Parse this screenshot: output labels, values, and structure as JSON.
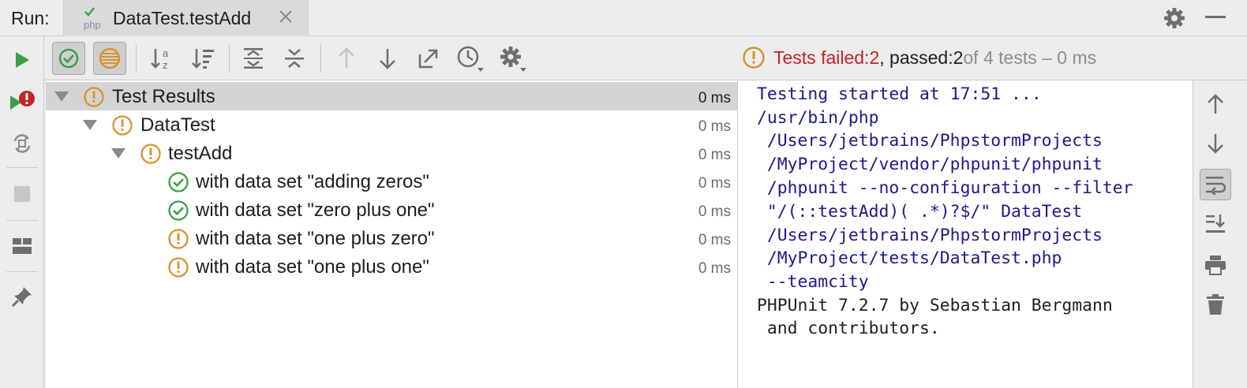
{
  "header": {
    "run_label": "Run:",
    "tab_title": "DataTest.testAdd",
    "tab_icon_text": "php",
    "tab_icon": "php-test-icon",
    "close_icon": "close-icon",
    "settings_icon": "gear-icon",
    "minimize_icon": "minimize-icon"
  },
  "left_toolbar": {
    "items": [
      {
        "icon": "run-icon"
      },
      {
        "icon": "rerun-failed-tests-icon"
      },
      {
        "icon": "toggle-auto-test-icon"
      },
      {
        "icon": "stop-icon"
      },
      {
        "icon": "restore-layout-icon"
      },
      {
        "icon": "pin-tab-icon"
      }
    ]
  },
  "toolbar": {
    "buttons": [
      {
        "icon": "show-passed-icon",
        "toggled": true
      },
      {
        "icon": "show-ignored-icon",
        "toggled": true
      },
      {
        "icon": "sort-alphabetically-icon"
      },
      {
        "icon": "sort-by-duration-icon"
      },
      {
        "icon": "expand-all-icon"
      },
      {
        "icon": "collapse-all-icon"
      },
      {
        "icon": "previous-failed-test-icon"
      },
      {
        "icon": "next-failed-test-icon"
      },
      {
        "icon": "export-test-results-icon"
      },
      {
        "icon": "test-history-icon"
      },
      {
        "icon": "test-settings-icon"
      }
    ]
  },
  "status": {
    "icon": "warning-icon",
    "failed_label": "Tests failed: ",
    "failed_count": "2",
    "passed_label": ", passed: ",
    "passed_count": "2",
    "total_text": " of 4 tests – 0 ms",
    "colors": {
      "failed": "#c7222a",
      "muted": "#8c8c8c"
    }
  },
  "tree": {
    "rows": [
      {
        "label": "Test Results",
        "time": "0 ms",
        "status": "failed",
        "level": 0,
        "expanded": true,
        "selected": true
      },
      {
        "label": "DataTest",
        "time": "0 ms",
        "status": "failed",
        "level": 1,
        "expanded": true
      },
      {
        "label": "testAdd",
        "time": "0 ms",
        "status": "failed",
        "level": 2,
        "expanded": true
      },
      {
        "label": "with data set \"adding zeros\"",
        "time": "0 ms",
        "status": "passed",
        "level": 3
      },
      {
        "label": "with data set \"zero plus one\"",
        "time": "0 ms",
        "status": "passed",
        "level": 3
      },
      {
        "label": "with data set \"one plus zero\"",
        "time": "0 ms",
        "status": "failed",
        "level": 3
      },
      {
        "label": "with data set \"one plus one\"",
        "time": "0 ms",
        "status": "failed",
        "level": 3
      }
    ],
    "colors": {
      "passed": "#3e9e4a",
      "failed": "#d9922c",
      "selected_bg": "#d4d4d4"
    }
  },
  "console": {
    "lines": [
      {
        "text": "Testing started at 17:51 ...",
        "kind": "system"
      },
      {
        "text": "/usr/bin/php",
        "kind": "system"
      },
      {
        "text": " /Users/jetbrains/PhpstormProjects",
        "kind": "system"
      },
      {
        "text": " /MyProject/vendor/phpunit/phpunit",
        "kind": "system"
      },
      {
        "text": " /phpunit --no-configuration --filter",
        "kind": "system"
      },
      {
        "text": " \"/(::testAdd)( .*)?$/\" DataTest",
        "kind": "system"
      },
      {
        "text": " /Users/jetbrains/PhpstormProjects",
        "kind": "system"
      },
      {
        "text": " /MyProject/tests/DataTest.php",
        "kind": "system"
      },
      {
        "text": " --teamcity",
        "kind": "system"
      },
      {
        "text": "PHPUnit 7.2.7 by Sebastian Bergmann",
        "kind": "output"
      },
      {
        "text": " and contributors.",
        "kind": "output"
      }
    ],
    "colors": {
      "system": "#1a1a8a",
      "output": "#1e1e1e"
    }
  },
  "right_toolbar": {
    "items": [
      {
        "icon": "scroll-up-icon"
      },
      {
        "icon": "scroll-down-icon"
      },
      {
        "icon": "soft-wrap-icon",
        "toggled": true
      },
      {
        "icon": "scroll-to-end-icon"
      },
      {
        "icon": "print-icon"
      },
      {
        "icon": "clear-all-icon"
      }
    ]
  }
}
